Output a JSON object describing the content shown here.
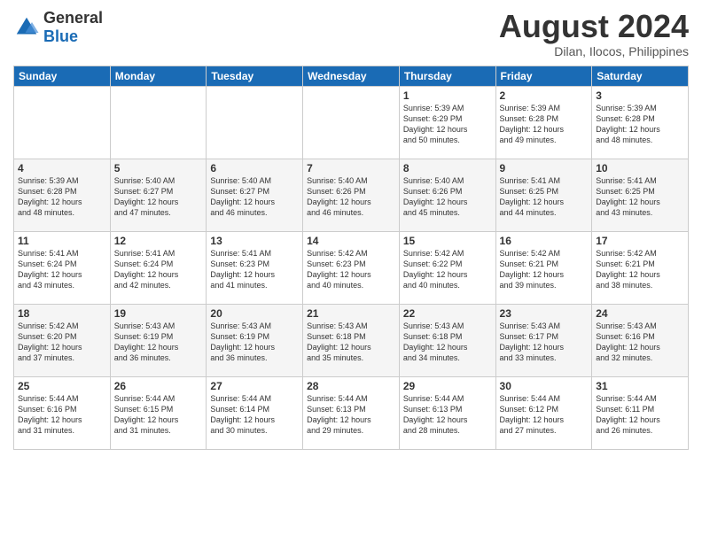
{
  "header": {
    "logo_general": "General",
    "logo_blue": "Blue",
    "month_year": "August 2024",
    "location": "Dilan, Ilocos, Philippines"
  },
  "days_of_week": [
    "Sunday",
    "Monday",
    "Tuesday",
    "Wednesday",
    "Thursday",
    "Friday",
    "Saturday"
  ],
  "weeks": [
    [
      {
        "day": "",
        "info": ""
      },
      {
        "day": "",
        "info": ""
      },
      {
        "day": "",
        "info": ""
      },
      {
        "day": "",
        "info": ""
      },
      {
        "day": "1",
        "info": "Sunrise: 5:39 AM\nSunset: 6:29 PM\nDaylight: 12 hours\nand 50 minutes."
      },
      {
        "day": "2",
        "info": "Sunrise: 5:39 AM\nSunset: 6:28 PM\nDaylight: 12 hours\nand 49 minutes."
      },
      {
        "day": "3",
        "info": "Sunrise: 5:39 AM\nSunset: 6:28 PM\nDaylight: 12 hours\nand 48 minutes."
      }
    ],
    [
      {
        "day": "4",
        "info": "Sunrise: 5:39 AM\nSunset: 6:28 PM\nDaylight: 12 hours\nand 48 minutes."
      },
      {
        "day": "5",
        "info": "Sunrise: 5:40 AM\nSunset: 6:27 PM\nDaylight: 12 hours\nand 47 minutes."
      },
      {
        "day": "6",
        "info": "Sunrise: 5:40 AM\nSunset: 6:27 PM\nDaylight: 12 hours\nand 46 minutes."
      },
      {
        "day": "7",
        "info": "Sunrise: 5:40 AM\nSunset: 6:26 PM\nDaylight: 12 hours\nand 46 minutes."
      },
      {
        "day": "8",
        "info": "Sunrise: 5:40 AM\nSunset: 6:26 PM\nDaylight: 12 hours\nand 45 minutes."
      },
      {
        "day": "9",
        "info": "Sunrise: 5:41 AM\nSunset: 6:25 PM\nDaylight: 12 hours\nand 44 minutes."
      },
      {
        "day": "10",
        "info": "Sunrise: 5:41 AM\nSunset: 6:25 PM\nDaylight: 12 hours\nand 43 minutes."
      }
    ],
    [
      {
        "day": "11",
        "info": "Sunrise: 5:41 AM\nSunset: 6:24 PM\nDaylight: 12 hours\nand 43 minutes."
      },
      {
        "day": "12",
        "info": "Sunrise: 5:41 AM\nSunset: 6:24 PM\nDaylight: 12 hours\nand 42 minutes."
      },
      {
        "day": "13",
        "info": "Sunrise: 5:41 AM\nSunset: 6:23 PM\nDaylight: 12 hours\nand 41 minutes."
      },
      {
        "day": "14",
        "info": "Sunrise: 5:42 AM\nSunset: 6:23 PM\nDaylight: 12 hours\nand 40 minutes."
      },
      {
        "day": "15",
        "info": "Sunrise: 5:42 AM\nSunset: 6:22 PM\nDaylight: 12 hours\nand 40 minutes."
      },
      {
        "day": "16",
        "info": "Sunrise: 5:42 AM\nSunset: 6:21 PM\nDaylight: 12 hours\nand 39 minutes."
      },
      {
        "day": "17",
        "info": "Sunrise: 5:42 AM\nSunset: 6:21 PM\nDaylight: 12 hours\nand 38 minutes."
      }
    ],
    [
      {
        "day": "18",
        "info": "Sunrise: 5:42 AM\nSunset: 6:20 PM\nDaylight: 12 hours\nand 37 minutes."
      },
      {
        "day": "19",
        "info": "Sunrise: 5:43 AM\nSunset: 6:19 PM\nDaylight: 12 hours\nand 36 minutes."
      },
      {
        "day": "20",
        "info": "Sunrise: 5:43 AM\nSunset: 6:19 PM\nDaylight: 12 hours\nand 36 minutes."
      },
      {
        "day": "21",
        "info": "Sunrise: 5:43 AM\nSunset: 6:18 PM\nDaylight: 12 hours\nand 35 minutes."
      },
      {
        "day": "22",
        "info": "Sunrise: 5:43 AM\nSunset: 6:18 PM\nDaylight: 12 hours\nand 34 minutes."
      },
      {
        "day": "23",
        "info": "Sunrise: 5:43 AM\nSunset: 6:17 PM\nDaylight: 12 hours\nand 33 minutes."
      },
      {
        "day": "24",
        "info": "Sunrise: 5:43 AM\nSunset: 6:16 PM\nDaylight: 12 hours\nand 32 minutes."
      }
    ],
    [
      {
        "day": "25",
        "info": "Sunrise: 5:44 AM\nSunset: 6:16 PM\nDaylight: 12 hours\nand 31 minutes."
      },
      {
        "day": "26",
        "info": "Sunrise: 5:44 AM\nSunset: 6:15 PM\nDaylight: 12 hours\nand 31 minutes."
      },
      {
        "day": "27",
        "info": "Sunrise: 5:44 AM\nSunset: 6:14 PM\nDaylight: 12 hours\nand 30 minutes."
      },
      {
        "day": "28",
        "info": "Sunrise: 5:44 AM\nSunset: 6:13 PM\nDaylight: 12 hours\nand 29 minutes."
      },
      {
        "day": "29",
        "info": "Sunrise: 5:44 AM\nSunset: 6:13 PM\nDaylight: 12 hours\nand 28 minutes."
      },
      {
        "day": "30",
        "info": "Sunrise: 5:44 AM\nSunset: 6:12 PM\nDaylight: 12 hours\nand 27 minutes."
      },
      {
        "day": "31",
        "info": "Sunrise: 5:44 AM\nSunset: 6:11 PM\nDaylight: 12 hours\nand 26 minutes."
      }
    ]
  ]
}
